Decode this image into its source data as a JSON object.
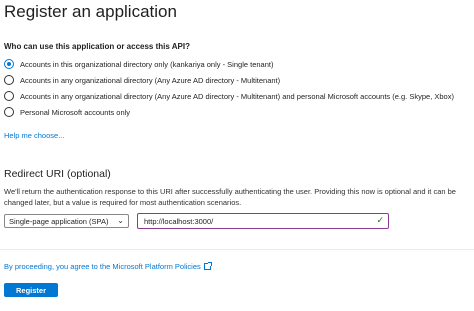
{
  "page": {
    "title": "Register an application"
  },
  "account_types": {
    "question": "Who can use this application or access this API?",
    "options": [
      {
        "label": "Accounts in this organizational directory only (kankariya only - Single tenant)",
        "selected": true
      },
      {
        "label": "Accounts in any organizational directory (Any Azure AD directory - Multitenant)",
        "selected": false
      },
      {
        "label": "Accounts in any organizational directory (Any Azure AD directory - Multitenant) and personal Microsoft accounts (e.g. Skype, Xbox)",
        "selected": false
      },
      {
        "label": "Personal Microsoft accounts only",
        "selected": false
      }
    ],
    "help_link": "Help me choose..."
  },
  "redirect": {
    "title": "Redirect URI (optional)",
    "description": "We'll return the authentication response to this URI after successfully authenticating the user. Providing this now is optional and it can be changed later, but a value is required for most authentication scenarios.",
    "platform_value": "Single-page application (SPA)",
    "uri_value": "http://localhost:3000/"
  },
  "footer": {
    "policy_link": "By proceeding, you agree to the Microsoft Platform Policies",
    "register_label": "Register"
  },
  "colors": {
    "accent": "#0078d4",
    "focus_border": "#8a3b8f",
    "valid": "#107c10"
  },
  "icons": {
    "chevron": "chevron-down-icon",
    "check": "check-icon",
    "external": "external-link-icon"
  }
}
